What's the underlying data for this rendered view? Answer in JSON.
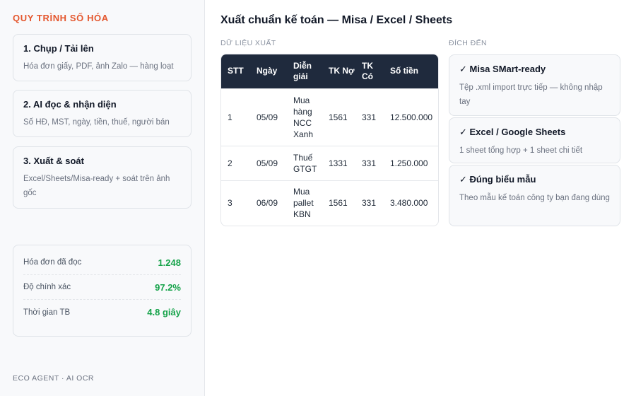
{
  "sidebar": {
    "title": "QUY TRÌNH SỐ HÓA",
    "steps": [
      {
        "title": "1. Chụp / Tải lên",
        "desc": "Hóa đơn giấy, PDF, ảnh Zalo — hàng loạt"
      },
      {
        "title": "2. AI đọc & nhận diện",
        "desc": "Số HĐ, MST, ngày, tiền, thuế, người bán"
      },
      {
        "title": "3. Xuất & soát",
        "desc": "Excel/Sheets/Misa-ready + soát trên ảnh gốc"
      }
    ],
    "stats": [
      {
        "label": "Hóa đơn đã đọc",
        "value": "1.248"
      },
      {
        "label": "Độ chính xác",
        "value": "97.2%"
      },
      {
        "label": "Thời gian TB",
        "value": "4.8 giây"
      }
    ],
    "footer": "ECO AGENT · AI OCR"
  },
  "main": {
    "title": "Xuất chuẩn kế toán — Misa / Excel / Sheets",
    "data_label": "DỮ LIỆU XUẤT",
    "dest_label": "ĐÍCH ĐẾN",
    "table": {
      "headers": [
        "STT",
        "Ngày",
        "Diễn giải",
        "TK Nợ",
        "TK Có",
        "Số tiền"
      ],
      "rows": [
        [
          "1",
          "05/09",
          "Mua hàng NCC Xanh",
          "1561",
          "331",
          "12.500.000"
        ],
        [
          "2",
          "05/09",
          "Thuế GTGT",
          "1331",
          "331",
          "1.250.000"
        ],
        [
          "3",
          "06/09",
          "Mua pallet KBN",
          "1561",
          "331",
          "3.480.000"
        ]
      ]
    },
    "destinations": [
      {
        "title": "✓ Misa SMart-ready",
        "desc": "Tệp .xml import trực tiếp — không nhập tay"
      },
      {
        "title": "✓ Excel / Google Sheets",
        "desc": "1 sheet tổng hợp + 1 sheet chi tiết"
      },
      {
        "title": "✓ Đúng biểu mẫu",
        "desc": "Theo mẫu kế toán công ty bạn đang dùng"
      }
    ]
  },
  "colors": {
    "accent": "#e4572e",
    "table_header": "#1f2a3d",
    "stat_value": "#16a34a"
  }
}
